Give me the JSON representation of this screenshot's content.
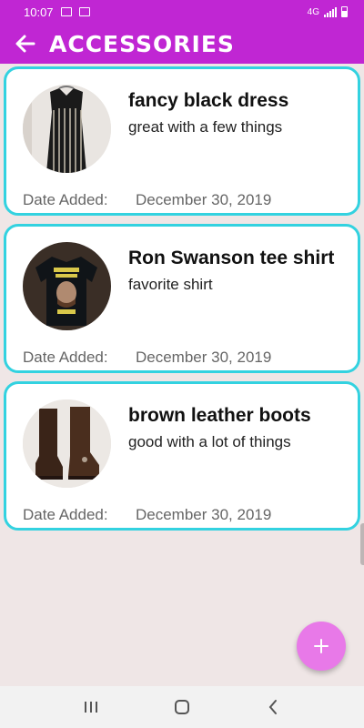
{
  "status_bar": {
    "time": "10:07",
    "network": "4G"
  },
  "app_bar": {
    "title": "ACCESSORIES"
  },
  "items": [
    {
      "name": "fancy black dress",
      "description": "great with a few things",
      "date_label": "Date Added:",
      "date": "December 30, 2019"
    },
    {
      "name": "Ron Swanson tee shirt",
      "description": "favorite shirt",
      "date_label": "Date Added:",
      "date": "December 30, 2019"
    },
    {
      "name": "brown leather boots",
      "description": "good with a lot of things",
      "date_label": "Date Added:",
      "date": "December 30, 2019"
    }
  ],
  "fab": {
    "label": "+"
  },
  "colors": {
    "primary": "#c026d3",
    "card_border": "#33d2e0",
    "fab": "#e879e8",
    "background": "#efe6e6"
  },
  "icons": {
    "back": "arrow-left-icon",
    "nav_recents": "recents-icon",
    "nav_home": "home-icon",
    "nav_back": "chevron-left-icon"
  }
}
